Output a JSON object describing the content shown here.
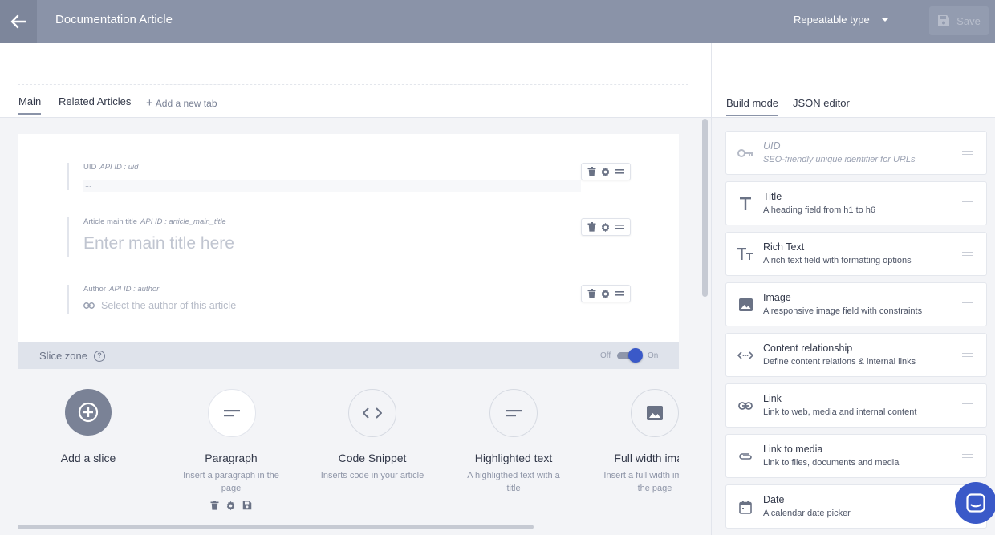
{
  "header": {
    "title": "Documentation Article",
    "type_select": "Repeatable type",
    "save_label": "Save"
  },
  "tabs": {
    "items": [
      "Main",
      "Related Articles"
    ],
    "add_label": "Add a new tab"
  },
  "fields": [
    {
      "label": "UID",
      "api_id": "API ID : uid",
      "value": "..."
    },
    {
      "label": "Article main title",
      "api_id": "API ID : article_main_title",
      "placeholder": "Enter main title here"
    },
    {
      "label": "Author",
      "api_id": "API ID : author",
      "placeholder": "Select the author of this article"
    }
  ],
  "slice_zone": {
    "label": "Slice zone",
    "help": "?",
    "off_label": "Off",
    "on_label": "On",
    "enabled": true
  },
  "slices": [
    {
      "name": "Add a slice",
      "desc": "",
      "icon": "plus-circle-icon"
    },
    {
      "name": "Paragraph",
      "desc": "Insert a paragraph in the page",
      "icon": "paragraph-icon"
    },
    {
      "name": "Code Snippet",
      "desc": "Inserts code in your article",
      "icon": "code-icon"
    },
    {
      "name": "Highlighted text",
      "desc": "A highligthed text with a title",
      "icon": "paragraph-icon"
    },
    {
      "name": "Full width image",
      "desc": "Insert a full width image in the page",
      "icon": "image-icon"
    }
  ],
  "sidebar": {
    "tabs": [
      "Build mode",
      "JSON editor"
    ],
    "fields": [
      {
        "name": "UID",
        "desc": "SEO-friendly unique identifier for URLs",
        "icon": "key-icon"
      },
      {
        "name": "Title",
        "desc": "A heading field from h1 to h6",
        "icon": "title-icon"
      },
      {
        "name": "Rich Text",
        "desc": "A rich text field with formatting options",
        "icon": "rich-text-icon"
      },
      {
        "name": "Image",
        "desc": "A responsive image field with constraints",
        "icon": "image-icon"
      },
      {
        "name": "Content relationship",
        "desc": "Define content relations & internal links",
        "icon": "relationship-icon"
      },
      {
        "name": "Link",
        "desc": "Link to web, media and internal content",
        "icon": "link-icon"
      },
      {
        "name": "Link to media",
        "desc": "Link to files, documents and media",
        "icon": "paperclip-icon"
      },
      {
        "name": "Date",
        "desc": "A calendar date picker",
        "icon": "calendar-icon"
      }
    ]
  },
  "colors": {
    "header": "#8a93a8",
    "accent": "#3a59c8"
  }
}
